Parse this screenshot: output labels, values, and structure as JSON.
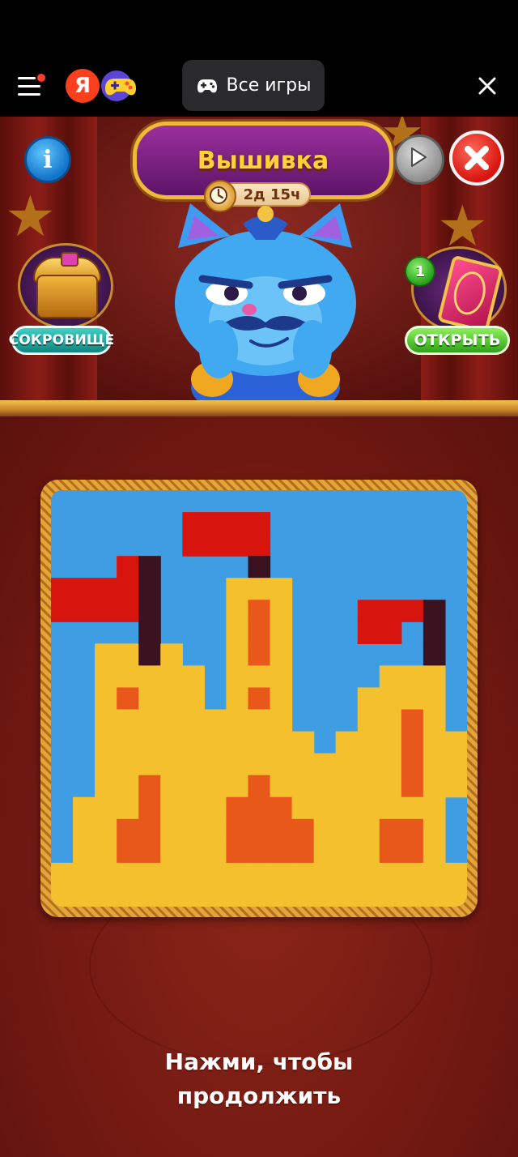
{
  "browser_bar": {
    "yandex_logo_letter": "Я",
    "all_games_label": "Все игры"
  },
  "game": {
    "title": "Вышивка",
    "timer": "2д 15ч",
    "treasure_label": "СОКРОВИЩЕ",
    "open_label": "ОТКРЫТЬ",
    "open_badge_count": "1",
    "continue_line1": "Нажми, чтобы",
    "continue_line2": "продолжить",
    "colors": {
      "water": "#3f9ee3",
      "sand": "#f5c02e",
      "flag": "#d8140f",
      "pole": "#3a1220",
      "window": "#e8581a"
    },
    "puzzle_grid": [
      "BBBBBBBBBBBBBBBBBBB",
      "BBBBBBRRRRBBBBBBBBB",
      "BBBBBBRRRRBBBBBBBBB",
      "BBBRPBBBBPBBBBBBBBB",
      "RRRRPBBBYYYBBBBBBBB",
      "RRRRPBBBYOYBBBRRRPB",
      "BBBBPBBBYOYBBBRRBPB",
      "BBYYPYBBYOYBBBBBBPB",
      "BBYYYYYBYYYBBBBYYYB",
      "BBYOYYYBYOYBBBYYYYB",
      "BBYYYYYYYYYBBBYYOYB",
      "BBYYYYYYYYYYBYYYOYY",
      "BBYYYYYYYYYYYYYYOYY",
      "BBYYOYYYYOYYYYYYOYY",
      "BYYYOYYYOOOYYYYYYYB",
      "BYYOOYYYOOOOYYYOOYB",
      "BYYOOYYYOOOOYYYOOYB",
      "YYYYYYYYYYYYYYYYYYY",
      "YYYYYYYYYYYYYYYYYYY"
    ]
  }
}
